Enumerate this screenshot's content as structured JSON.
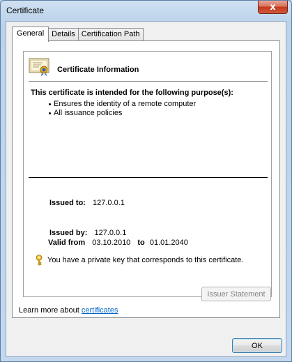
{
  "window": {
    "title": "Certificate",
    "close_label": "x"
  },
  "tabs": [
    {
      "label": "General",
      "active": true
    },
    {
      "label": "Details",
      "active": false
    },
    {
      "label": "Certification Path",
      "active": false
    }
  ],
  "general": {
    "info_title": "Certificate Information",
    "purpose_heading": "This certificate is intended for the following purpose(s):",
    "purposes": [
      "Ensures the identity of a remote computer",
      "All issuance policies"
    ],
    "issued_to_label": "Issued to:",
    "issued_to_value": "127.0.0.1",
    "issued_by_label": "Issued by:",
    "issued_by_value": "127.0.0.1",
    "valid_from_label": "Valid from",
    "valid_from_value": "03.10.2010",
    "valid_to_label": "to",
    "valid_to_value": "01.01.2040",
    "private_key_text": "You have a private key that corresponds to this certificate."
  },
  "buttons": {
    "issuer_statement": "Issuer Statement",
    "ok": "OK"
  },
  "learn_more": {
    "prefix": "Learn more about ",
    "link": "certificates"
  },
  "icons": {
    "certificate": "certificate-icon",
    "key": "key-icon"
  }
}
